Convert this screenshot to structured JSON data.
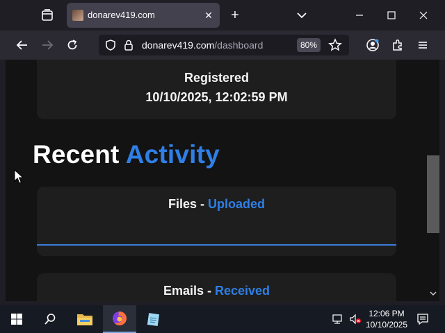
{
  "browser": {
    "tab": {
      "title": "donarev419.com"
    },
    "url": {
      "domain": "donarev419.com",
      "path": "/dashboard"
    },
    "zoom": "80%"
  },
  "page": {
    "registered": {
      "label": "Registered",
      "value": "10/10/2025, 12:02:59 PM"
    },
    "recent_activity": {
      "word1": "Recent",
      "word2": "Activity"
    },
    "files": {
      "label": "Files - ",
      "status": "Uploaded"
    },
    "emails": {
      "label": "Emails - ",
      "status": "Received"
    }
  },
  "taskbar": {
    "time": "12:06 PM",
    "date": "10/10/2025",
    "items": [
      "start-icon",
      "search-icon",
      "file-explorer-icon",
      "firefox-icon",
      "notepad-icon"
    ]
  },
  "colors": {
    "accent": "#2f7fe6",
    "card": "#1e1e1e",
    "page_bg": "#131313",
    "chrome": "#2b2a33"
  }
}
